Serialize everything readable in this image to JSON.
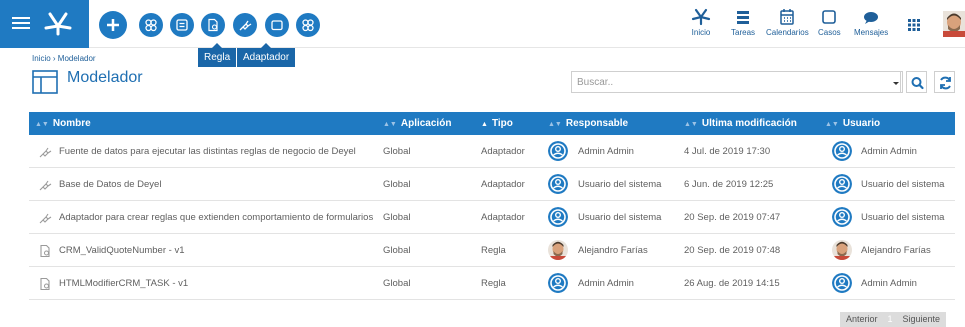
{
  "tooltips": {
    "regla": "Regla",
    "adaptador": "Adaptador"
  },
  "nav": [
    {
      "label": "Inicio"
    },
    {
      "label": "Tareas"
    },
    {
      "label": "Calendarios"
    },
    {
      "label": "Casos"
    },
    {
      "label": "Mensajes"
    }
  ],
  "breadcrumb": "Inicio › Modelador",
  "page_title": "Modelador",
  "search": {
    "placeholder": "Buscar.."
  },
  "columns": [
    {
      "label": "Nombre",
      "sort": "none"
    },
    {
      "label": "Aplicación",
      "sort": "none"
    },
    {
      "label": "Tipo",
      "sort": "asc"
    },
    {
      "label": "Responsable",
      "sort": "none"
    },
    {
      "label": "Ultima modificación",
      "sort": "none"
    },
    {
      "label": "Usuario",
      "sort": "none"
    }
  ],
  "rows": [
    {
      "icon": "plug-icon",
      "name": "Fuente de datos para ejecutar las distintas reglas de negocio de Deyel",
      "app": "Global",
      "type": "Adaptador",
      "owner": "Admin Admin",
      "owner_avatar": "user-circle",
      "modified": "4 Jul. de 2019 17:30",
      "user": "Admin Admin",
      "user_avatar": "user-circle"
    },
    {
      "icon": "plug-icon",
      "name": "Base de Datos de Deyel",
      "app": "Global",
      "type": "Adaptador",
      "owner": "Usuario del sistema",
      "owner_avatar": "user-circle",
      "modified": "6 Jun. de 2019 12:25",
      "user": "Usuario del sistema",
      "user_avatar": "user-circle"
    },
    {
      "icon": "plug-icon",
      "name": "Adaptador para crear reglas que extienden comportamiento de formularios",
      "app": "Global",
      "type": "Adaptador",
      "owner": "Usuario del sistema",
      "owner_avatar": "user-circle",
      "modified": "20 Sep. de 2019 07:47",
      "user": "Usuario del sistema",
      "user_avatar": "user-circle"
    },
    {
      "icon": "rule-doc-icon",
      "name": "CRM_ValidQuoteNumber - v1",
      "app": "Global",
      "type": "Regla",
      "owner": "Alejandro Farías",
      "owner_avatar": "photo",
      "modified": "20 Sep. de 2019 07:48",
      "user": "Alejandro Farías",
      "user_avatar": "photo"
    },
    {
      "icon": "rule-doc-icon",
      "name": "HTMLModifierCRM_TASK - v1",
      "app": "Global",
      "type": "Regla",
      "owner": "Admin Admin",
      "owner_avatar": "user-circle",
      "modified": "26 Aug. de 2019 14:15",
      "user": "Admin Admin",
      "user_avatar": "user-circle"
    }
  ],
  "pager": {
    "prev": "Anterior",
    "page": "1",
    "next": "Siguiente"
  },
  "colors": {
    "primary": "#1f7ac2",
    "header_text": "#ffffff",
    "title": "#1f6fb2"
  }
}
